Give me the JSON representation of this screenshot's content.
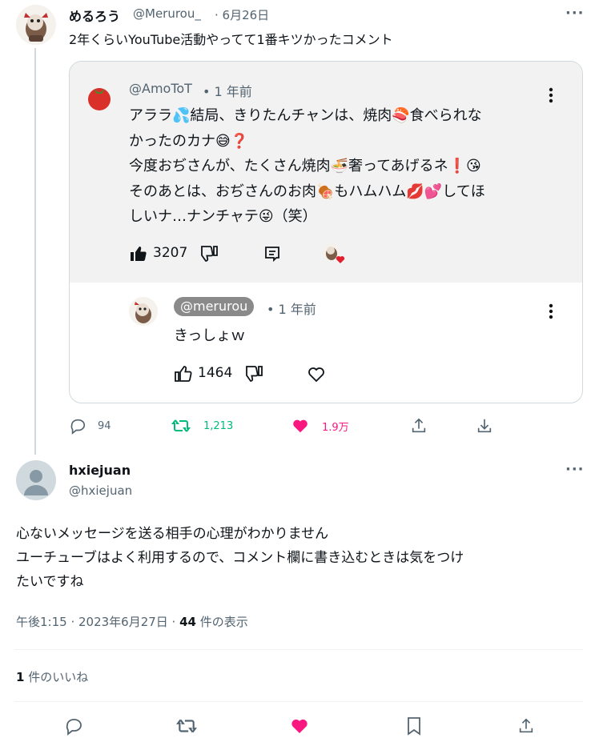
{
  "tweet1": {
    "name": "めるろう",
    "handle": "@Merurou_",
    "date": "· 6月26日",
    "text": "2年くらいYouTube活動やってて1番キツかったコメント",
    "quote": {
      "author": "@AmoToT",
      "time": "• 1 年前",
      "lines": [
        "アララ💦結局、きりたんチャンは、焼肉🍣食べられな",
        "かったのカナ😅❓",
        "今度おぢさんが、たくさん焼肉🍜奢ってあげるネ❗😘",
        "そのあとは、おぢさんのお肉🍖もハムハム💋💕してほ",
        "しいナ…ナンチャテ😜（笑）"
      ],
      "likes": "3207",
      "reply_author": "@merurou",
      "reply_time": "• 1 年前",
      "reply_text": "きっしょｗ",
      "reply_likes": "1464"
    },
    "actions": {
      "replies": "94",
      "retweets": "1,213",
      "likes": "1.9万"
    },
    "colors": {
      "retweet": "#00ba7c",
      "like": "#f91880"
    }
  },
  "tweet2": {
    "name": "hxiejuan",
    "handle": "@hxiejuan",
    "line1": "心ないメッセージを送る相手の心理がわかりません",
    "line2": "ユーチューブはよく利用するので、コメント欄に書き込むときは気をつけ",
    "line3": "たいですね",
    "timestamp": "午後1:15 · 2023年6月27日 · ",
    "views_count": "44",
    "views_label": " 件の表示",
    "likes_count": "1",
    "likes_label": " 件のいいね"
  },
  "icons": [
    "reply-icon",
    "retweet-icon",
    "like-icon",
    "share-icon",
    "download-icon",
    "bookmark-icon",
    "more-icon",
    "thumbs-up-icon",
    "thumbs-down-icon",
    "comment-icon",
    "heart-outline-icon"
  ]
}
